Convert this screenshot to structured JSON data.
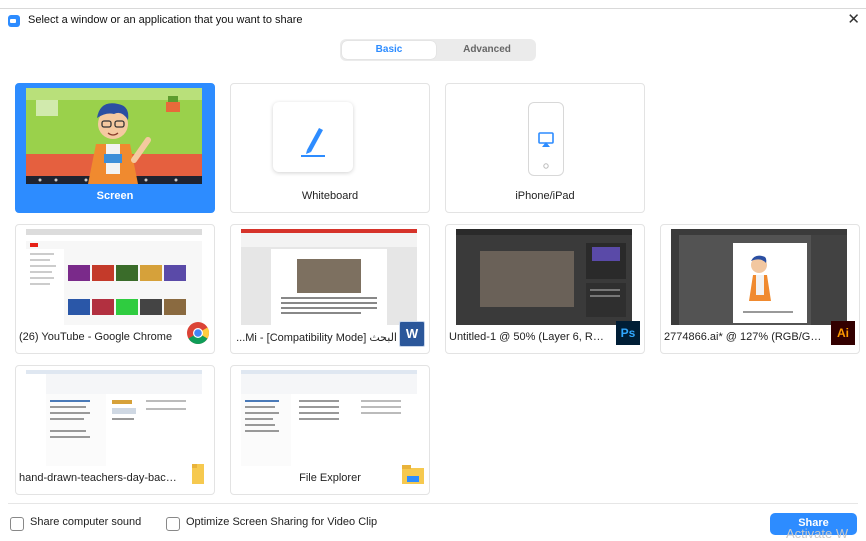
{
  "window": {
    "title": "Select a window or an application that you want to share",
    "close_glyph": "✕"
  },
  "tabs": [
    {
      "label": "Basic",
      "selected": true
    },
    {
      "label": "Advanced",
      "selected": false
    }
  ],
  "tiles": [
    {
      "label": "Screen",
      "selected": true
    },
    {
      "label": "Whiteboard"
    },
    {
      "label": "iPhone/iPad"
    },
    {
      "label": "(26) YouTube - Google Chrome",
      "app_icon": "chrome-icon"
    },
    {
      "label": "البحث [Compatibility Mode] - Mi...",
      "app_icon": "word-icon",
      "badge": "W"
    },
    {
      "label": "Untitled-1 @ 50% (Layer 6, RGB/8...",
      "app_icon": "photoshop-icon",
      "badge": "Ps"
    },
    {
      "label": "2774866.ai* @ 127% (RGB/GPU Pr...",
      "app_icon": "illustrator-icon",
      "badge": "Ai"
    },
    {
      "label": "hand-drawn-teachers-day-backg...",
      "app_icon": "folder-icon"
    },
    {
      "label": "File Explorer",
      "app_icon": "file-explorer-icon"
    }
  ],
  "footer": {
    "share_sound_label": "Share computer sound",
    "share_sound_checked": false,
    "optimize_label": "Optimize Screen Sharing for Video Clip",
    "optimize_checked": false,
    "share_button": "Share",
    "watermark": "Activate W"
  },
  "colors": {
    "accent": "#2d8cff"
  }
}
